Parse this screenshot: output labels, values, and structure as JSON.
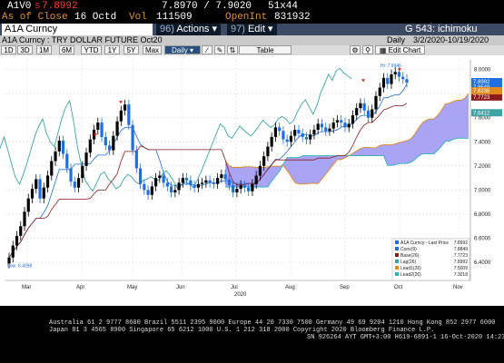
{
  "topbar": {
    "ticker": "A1V0",
    "last_prefix": "s",
    "last_value": "7.8992",
    "bid_ask": "7.8970 / 7.9020",
    "size": "51x44",
    "close_label": "As of Close",
    "close_date": "16 Octd",
    "vol_label": "Vol",
    "vol_value": "111509",
    "openint_label": "OpenInt",
    "openint_value": "831932"
  },
  "titlebar": {
    "security": "A1A Curncy",
    "menu_num_1": "96)",
    "actions": "Actions",
    "menu_num_2": "97)",
    "edit": "Edit",
    "chart_name": "G 543: ichimoku"
  },
  "infobar": {
    "description": "A1A Curncy : TRY DOLLAR FUTURE Oct20",
    "period": "Daily",
    "range": "3/2/2020-10/19/2020"
  },
  "toolbar": {
    "buttons": [
      "1D",
      "3D",
      "1M",
      "6M",
      "YTD",
      "1Y",
      "5Y",
      "Max"
    ],
    "frequency": "Daily",
    "table": "Table",
    "edit_chart": "Edit Chart"
  },
  "colors": {
    "up_candle": "#000000",
    "down_candle": "#1f6fe0",
    "conversion": "#1f6fe0",
    "base": "#8b1a1a",
    "lag": "#3fa3a3",
    "lead1": "#e08a1e",
    "lead2": "#2bb6b6",
    "cloud": "#8c86f0"
  },
  "chart_data": {
    "type": "candlestick-ichimoku",
    "x_labels": [
      "Mar",
      "Apr",
      "May",
      "Jun",
      "Jul",
      "Aug",
      "Sep",
      "Oct",
      "Nov"
    ],
    "year_label": "2020",
    "y_ticks": [
      "8.0000",
      "7.8000",
      "7.6000",
      "7.4000",
      "7.2000",
      "7.0000",
      "6.8000",
      "6.6000",
      "6.4000"
    ],
    "ylim": [
      6.25,
      8.08
    ],
    "high_annotation": "Hi: 7.9946",
    "low_annotation": "Low: 6.4098",
    "price_tags": [
      {
        "value": "7.8992",
        "color": "#1f6fe0"
      },
      {
        "value": "7.8549",
        "color": "#1f6fe0"
      },
      {
        "value": "7.7723",
        "color": "#8b1a1a"
      },
      {
        "value": "7.8236",
        "color": "#e08a1e"
      },
      {
        "value": "7.6412",
        "color": "#3fa3a3"
      }
    ],
    "close": [
      6.44,
      6.54,
      6.62,
      6.7,
      6.82,
      6.93,
      7.01,
      7.09,
      6.93,
      7.02,
      7.12,
      7.24,
      7.32,
      7.41,
      7.3,
      7.18,
      7.07,
      7.02,
      7.1,
      7.2,
      7.31,
      7.42,
      7.5,
      7.56,
      7.44,
      7.37,
      7.33,
      7.45,
      7.57,
      7.66,
      7.71,
      7.54,
      7.33,
      7.18,
      7.05,
      7.0,
      6.96,
      7.03,
      7.1,
      7.12,
      7.06,
      7.03,
      6.98,
      7.0,
      7.06,
      7.1,
      7.08,
      7.04,
      7.02,
      7.05,
      7.06,
      7.08,
      7.06,
      7.05,
      7.1,
      7.13,
      7.09,
      7.04,
      6.98,
      7.01,
      7.04,
      7.02,
      6.99,
      7.05,
      7.12,
      7.2,
      7.28,
      7.36,
      7.44,
      7.52,
      7.49,
      7.42,
      7.4,
      7.45,
      7.5,
      7.47,
      7.44,
      7.42,
      7.46,
      7.5,
      7.55,
      7.52,
      7.49,
      7.51,
      7.56,
      7.58,
      7.56,
      7.52,
      7.55,
      7.62,
      7.68,
      7.72,
      7.66,
      7.6,
      7.67,
      7.78,
      7.85,
      7.93,
      7.88,
      7.96,
      7.98,
      7.94,
      7.92,
      7.89
    ],
    "series": [
      {
        "name": "A1A Curncy - Last Price",
        "value": "7.8992"
      },
      {
        "name": "Conv(9)",
        "value": "7.8849"
      },
      {
        "name": "Base(26)",
        "value": "7.7723"
      },
      {
        "name": "Lag(26)",
        "value": "7.8992"
      },
      {
        "name": "Lead1(26)",
        "value": "7.5009"
      },
      {
        "name": "Lead2(26)",
        "value": "7.3018"
      }
    ]
  },
  "footer": {
    "line1": "Australia 61 2 9777 8600 Brazil 5511 2395 9000 Europe 44 20 7330 7500 Germany 49 69 9204 1210 Hong Kong 852 2977 6000",
    "line2": "Japan 81 3 4565 8900        Singapore 65 6212 1000        U.S. 1 212 318 2000              Copyright 2020 Bloomberg Finance L.P.",
    "line3": "SN 926264 AYT  GMT+3:00 H619-6891-1 16-Oct-2020 14:23:33"
  }
}
